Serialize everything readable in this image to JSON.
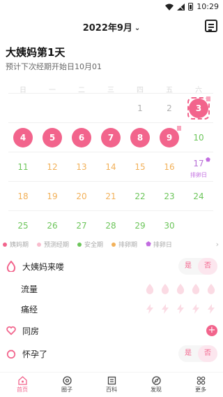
{
  "status": {
    "time": "10:29"
  },
  "header": {
    "month": "2022年9月"
  },
  "cycle": {
    "title": "大姨妈第1天",
    "subtitle": "预计下次经期开始日10月01"
  },
  "weekdays": [
    "日",
    "一",
    "二",
    "三",
    "四",
    "五",
    "六"
  ],
  "calendar": {
    "ovulation_label": "排卵日",
    "rows": [
      [
        {
          "day": ""
        },
        {
          "day": ""
        },
        {
          "day": ""
        },
        {
          "day": ""
        },
        {
          "day": "1",
          "tone": "gray"
        },
        {
          "day": "2",
          "tone": "gray"
        },
        {
          "day": "3",
          "tone": "period",
          "today": true,
          "flag": true
        }
      ],
      [
        {
          "day": "4",
          "tone": "period"
        },
        {
          "day": "5",
          "tone": "period"
        },
        {
          "day": "6",
          "tone": "period"
        },
        {
          "day": "7",
          "tone": "period"
        },
        {
          "day": "8",
          "tone": "period"
        },
        {
          "day": "9",
          "tone": "period",
          "flag": true
        },
        {
          "day": "10",
          "tone": "green"
        }
      ],
      [
        {
          "day": "11",
          "tone": "green"
        },
        {
          "day": "12",
          "tone": "orange"
        },
        {
          "day": "13",
          "tone": "orange"
        },
        {
          "day": "14",
          "tone": "orange"
        },
        {
          "day": "15",
          "tone": "orange"
        },
        {
          "day": "16",
          "tone": "orange"
        },
        {
          "day": "17",
          "tone": "purple",
          "ovulation": true
        }
      ],
      [
        {
          "day": "18",
          "tone": "orange"
        },
        {
          "day": "19",
          "tone": "orange"
        },
        {
          "day": "20",
          "tone": "orange"
        },
        {
          "day": "21",
          "tone": "orange"
        },
        {
          "day": "22",
          "tone": "green"
        },
        {
          "day": "23",
          "tone": "green"
        },
        {
          "day": "24",
          "tone": "green"
        }
      ],
      [
        {
          "day": "25",
          "tone": "green"
        },
        {
          "day": "26",
          "tone": "green"
        },
        {
          "day": "27",
          "tone": "green"
        },
        {
          "day": "28",
          "tone": "green"
        },
        {
          "day": "29",
          "tone": "green"
        },
        {
          "day": "30",
          "tone": "green"
        },
        {
          "day": ""
        }
      ]
    ]
  },
  "legend": [
    {
      "label": "姨妈期",
      "color": "#f2648c"
    },
    {
      "label": "预测经期",
      "color": "#f9bccd"
    },
    {
      "label": "安全期",
      "color": "#6cc55a"
    },
    {
      "label": "排卵期",
      "color": "#f2b15a"
    },
    {
      "label": "排卵日",
      "color": "#c26ce0",
      "star": true
    }
  ],
  "records": {
    "period": {
      "label": "大姨妈来喽",
      "yes": "是",
      "no": "否"
    },
    "flow": {
      "label": "流量"
    },
    "pain": {
      "label": "痛经"
    },
    "intimacy": {
      "label": "同房"
    },
    "pregnant": {
      "label": "怀孕了",
      "yes": "是",
      "no": "否"
    }
  },
  "tabs": [
    {
      "label": "首页",
      "icon": "home-icon",
      "active": true
    },
    {
      "label": "圈子",
      "icon": "circle-icon"
    },
    {
      "label": "百科",
      "icon": "book-icon"
    },
    {
      "label": "发现",
      "icon": "compass-icon"
    },
    {
      "label": "更多",
      "icon": "grid-icon"
    }
  ],
  "colors": {
    "accent": "#f2648c",
    "safe": "#6cc55a",
    "ovulation_period": "#f2b15a",
    "ovulation_day": "#c26ce0"
  }
}
